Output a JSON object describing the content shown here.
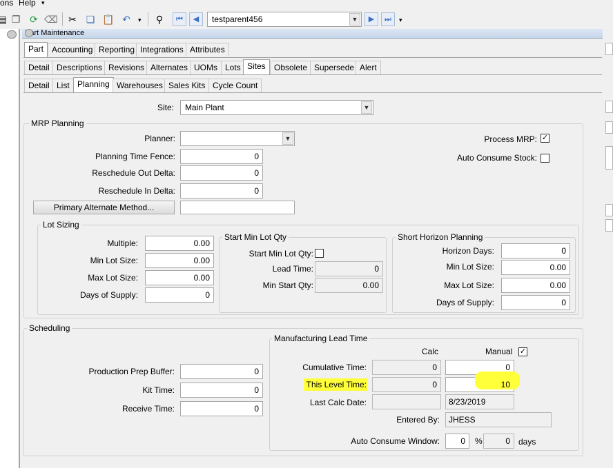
{
  "menu": {
    "ons": "ons",
    "help": "Help"
  },
  "toolbar": {
    "search_value": "testparent456"
  },
  "window": {
    "title": "Part Maintenance"
  },
  "tabs_l1": [
    "Part",
    "Accounting",
    "Reporting",
    "Integrations",
    "Attributes"
  ],
  "tabs_l2": [
    "Detail",
    "Descriptions",
    "Revisions",
    "Alternates",
    "UOMs",
    "Lots",
    "Sites",
    "Obsolete",
    "Supersede",
    "Alert"
  ],
  "tabs_l3": [
    "Detail",
    "List",
    "Planning",
    "Warehouses",
    "Sales Kits",
    "Cycle Count"
  ],
  "site": {
    "label": "Site:",
    "value": "Main Plant"
  },
  "mrp": {
    "title": "MRP Planning",
    "planner_label": "Planner:",
    "planner_value": "",
    "ptf_label": "Planning Time Fence:",
    "ptf_value": "0",
    "rod_label": "Reschedule Out Delta:",
    "rod_value": "0",
    "rid_label": "Reschedule In Delta:",
    "rid_value": "0",
    "pam_button": "Primary Alternate Method...",
    "pam_value": "",
    "process_mrp_label": "Process MRP:",
    "process_mrp_checked": "✓",
    "auto_consume_label": "Auto Consume Stock:",
    "auto_consume_checked": ""
  },
  "lot_sizing": {
    "title": "Lot Sizing",
    "multiple_label": "Multiple:",
    "multiple_value": "0.00",
    "min_label": "Min Lot Size:",
    "min_value": "0.00",
    "max_label": "Max Lot Size:",
    "max_value": "0.00",
    "days_label": "Days of Supply:",
    "days_value": "0"
  },
  "start_min": {
    "title": "Start Min Lot Qty",
    "check_label": "Start Min Lot Qty:",
    "check_value": "",
    "lead_label": "Lead Time:",
    "lead_value": "0",
    "min_start_label": "Min Start Qty:",
    "min_start_value": "0.00"
  },
  "short_horizon": {
    "title": "Short Horizon Planning",
    "horizon_label": "Horizon Days:",
    "horizon_value": "0",
    "min_label": "Min Lot Size:",
    "min_value": "0.00",
    "max_label": "Max Lot Size:",
    "max_value": "0.00",
    "days_label": "Days of Supply:",
    "days_value": "0"
  },
  "scheduling": {
    "title": "Scheduling",
    "prep_label": "Production Prep Buffer:",
    "prep_value": "0",
    "kit_label": "Kit Time:",
    "kit_value": "0",
    "receive_label": "Receive Time:",
    "receive_value": "0"
  },
  "mlt": {
    "title": "Manufacturing Lead Time",
    "calc_header": "Calc",
    "manual_header": "Manual",
    "manual_checked": "✓",
    "cum_label": "Cumulative Time:",
    "cum_calc": "0",
    "cum_manual": "0",
    "level_label": "This Level Time:",
    "level_calc": "0",
    "level_manual": "10",
    "lastcalc_label": "Last Calc Date:",
    "lastcalc_calc": "",
    "lastcalc_manual": "8/23/2019",
    "entered_label": "Entered By:",
    "entered_value": "JHESS",
    "acw_label": "Auto Consume Window:",
    "acw_value": "0",
    "acw_pct": "%",
    "acw_days_value": "0",
    "acw_days": "days"
  },
  "colors": {
    "highlight": "#ffff3a",
    "accent": "#3b6fc4"
  }
}
